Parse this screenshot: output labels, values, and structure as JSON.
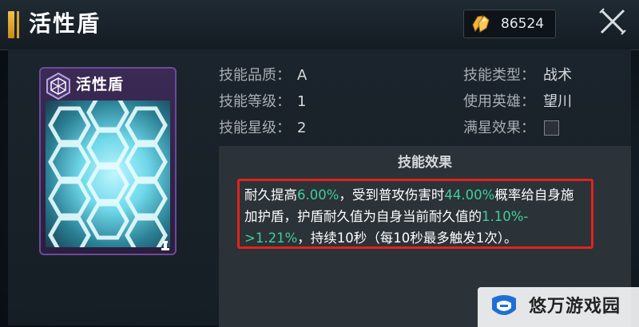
{
  "header": {
    "title": "活性盾",
    "currency_value": "86524"
  },
  "card": {
    "name": "活性盾"
  },
  "info": {
    "quality_label": "技能品质：",
    "quality_value": "A",
    "level_label": "技能等级：",
    "level_value": "1",
    "star_label": "技能星级：",
    "star_value": "2",
    "type_label": "技能类型：",
    "type_value": "战术",
    "hero_label": "使用英雄：",
    "hero_value": "望川",
    "fullstar_label": "满星效果："
  },
  "effect": {
    "title": "技能效果",
    "t1": "耐久提高",
    "v1": "6.00%",
    "t2": "，受到普攻伤害时",
    "v2": "44.00%",
    "t3": "概率给自身施加护盾，护盾耐久值为自身当前耐久值的",
    "v3": "1.10%->1.21%",
    "t4": "，持续10秒（每10秒最多触发1次）。"
  },
  "watermark": {
    "text": "悠万游戏园"
  },
  "colors": {
    "highlight": "#3fcf9a",
    "accent_gold": "#e8b23a",
    "box_border": "#e0241b"
  },
  "icons": {
    "currency": "gold-crystal-icon",
    "close": "close-icon",
    "badge": "hexagon-shield-badge-icon",
    "corner": "chess-piece-icon"
  }
}
